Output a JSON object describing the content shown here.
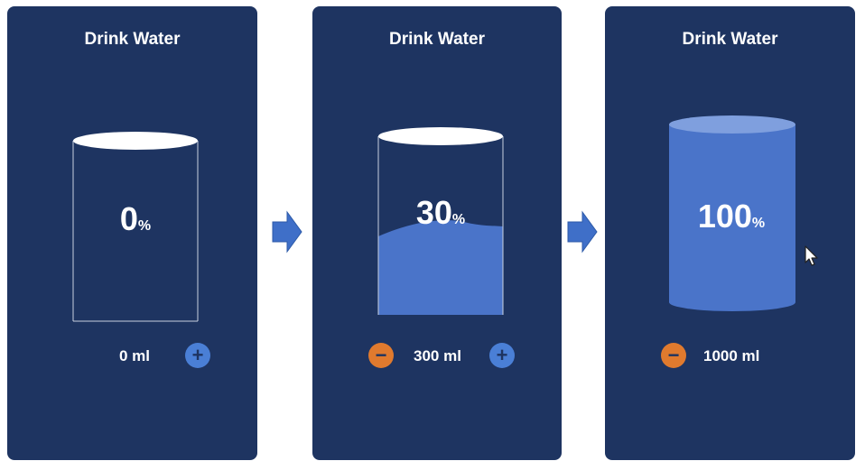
{
  "cards": [
    {
      "title": "Drink Water",
      "percent_value": "0",
      "percent_symbol": "%",
      "amount": "0 ml",
      "fill_level": 0
    },
    {
      "title": "Drink Water",
      "percent_value": "30",
      "percent_symbol": "%",
      "amount": "300 ml",
      "fill_level": 0.3
    },
    {
      "title": "Drink Water",
      "percent_value": "100",
      "percent_symbol": "%",
      "amount": "1000 ml",
      "fill_level": 1.0
    }
  ],
  "controls": {
    "minus_label": "−",
    "plus_label": "+"
  },
  "icons": {
    "arrow": "right-arrow-icon",
    "cursor": "mouse-cursor-icon"
  },
  "colors": {
    "panel_bg": "#1e3461",
    "water": "#4a74c9",
    "minus_button": "#e07a2e",
    "plus_button": "#4a7fd6",
    "arrow": "#3f6fc8"
  }
}
